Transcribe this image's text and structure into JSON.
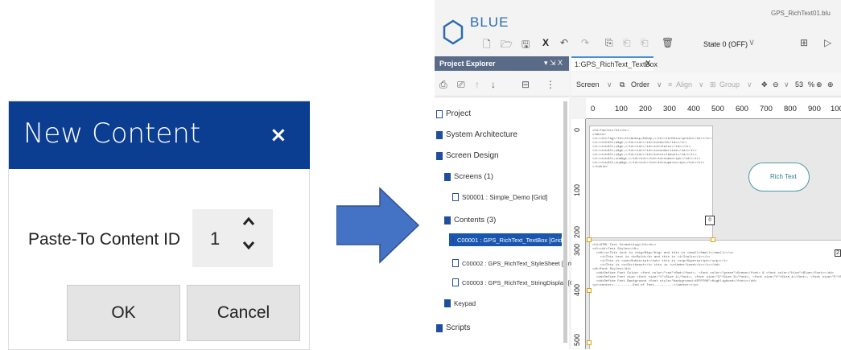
{
  "dialog": {
    "title": "New Content",
    "close_icon": "×",
    "field_label": "Paste-To Content ID",
    "field_value": "1",
    "ok_label": "OK",
    "cancel_label": "Cancel",
    "header_color": "#0b3d91"
  },
  "app": {
    "brand": "BLUE",
    "file_name": "GPS_RichText01.blu",
    "state_label": "State 0 (OFF)",
    "panel_title": "Project Explorer",
    "panel_pin": "▾ ⇲ X",
    "tab_label": "1:GPS_RichText_TextBox",
    "tab_close": "X",
    "editor_toolbar": {
      "screen": "Screen",
      "order": "Order",
      "align": "Align",
      "group": "Group",
      "zoom": "53",
      "zoom_unit": "%"
    },
    "tree": [
      {
        "label": "Project",
        "icon": "document-icon"
      },
      {
        "label": "System Architecture",
        "icon": "architecture-icon"
      },
      {
        "label": "Screen Design",
        "icon": "screen-design-icon"
      },
      {
        "label": "Screens (1)",
        "icon": "folder-icon"
      },
      {
        "label": "S00001 : Simple_Demo [Grid]",
        "icon": "screen-icon"
      },
      {
        "label": "Contents (3)",
        "icon": "folder-icon"
      },
      {
        "label": "C00001 : GPS_RichText_TextBox [Grid]",
        "icon": "content-icon",
        "selected": true
      },
      {
        "label": "C00002 : GPS_RichText_StyleSheet [Grid]",
        "icon": "content-icon"
      },
      {
        "label": "C00003 : GPS_RichText_StringDisplay [Gri",
        "icon": "content-icon"
      },
      {
        "label": "Keypad",
        "icon": "folder-icon"
      },
      {
        "label": "Scripts",
        "icon": "scripts-icon"
      }
    ],
    "ruler_h": [
      "0",
      "100",
      "200",
      "300",
      "400",
      "500",
      "600",
      "700",
      "800",
      "900",
      "100"
    ],
    "ruler_v": [
      "0",
      "100",
      "200",
      "300",
      "400",
      "500"
    ],
    "shape_label": "Rich Text",
    "content1_text": "<h1>Tables</h1><hr>\n<table>\n<tr><th>Tag</th><th>&nbsp;&nbsp;</th><th>Description</th></tr>\n<tr><td>&lt;b&gt;</td><td></td><td>bold</td></tr>\n<tr><td>&lt;i&gt;</td><td></td><td>italic</td></tr>\n<tr><td>&lt;u&gt;</td><td></td><td>underline</td></tr>\n<tr><td>&lt;s&gt;</td><td></td><td>strikeout</td></tr>\n<tr><td>&lt;sub&gt;</td><td></td><td>subscript</td></tr>\n<tr><td>&lt;sup&gt;</td><td></td><td>superscript</td></tr>\n</table>",
    "content2_text": "<h1>HTML Text Formatting</h1><hr>\n<dl><dt>Text Styles</dt>\n  <dd><u>This text is <big>Big</big> and this is <small>Small</small></u>\n    <i>This text is <b>Bold</b> and this is <i>Italic</i></i>\n    <i>This is <sub>Subscript</sub> this is <sup>Superscript</sup></i>\n    <i>This is <s>Strikeout</s> this is <u>Underlined</u></i></dd>\n<dt>Font Styles</dt>\n  <dd>Define Font Colour <font color=\"red\">Red</font>, <font color=\"green\">Green</font> & <font color=\"blue\">Blue</font></dd>\n  <dd>Define Font size <font size=\"1\">Size 1</font>, <font size=\"3\">Size 3</font>, <font size=\"4\">Size 4</font>, <font size=\"5\">Size 5</font></dd>\n  <dd>Define Font Background <font style=\"background:#FFFF00\">Highlighted</font></dd>\n<p><center>----------End of Text----------</center></p>",
    "num_tag": "0",
    "side_num": "2"
  },
  "colors": {
    "accent": "#1a56b0",
    "arrow": "#4472c4"
  }
}
